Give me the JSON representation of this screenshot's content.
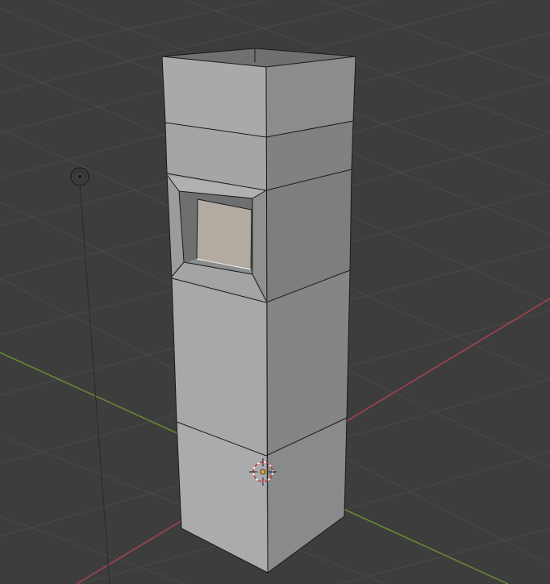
{
  "viewport": {
    "background_color": "#3d3d3d",
    "grid_color": "#4a4a4a",
    "x_axis_color": "#a8434f",
    "y_axis_color": "#6a8e2e"
  },
  "objects": {
    "tower": {
      "label": "",
      "face_light": "#a7a9ab",
      "face_mid": "#989a9c",
      "face_dark": "#7f8183",
      "window_glass": "#b3aba2"
    },
    "light": {
      "icon": "light-icon"
    },
    "cursor_3d": {
      "icon": "3d-cursor-icon",
      "origin_color": "#e8a23a"
    }
  }
}
